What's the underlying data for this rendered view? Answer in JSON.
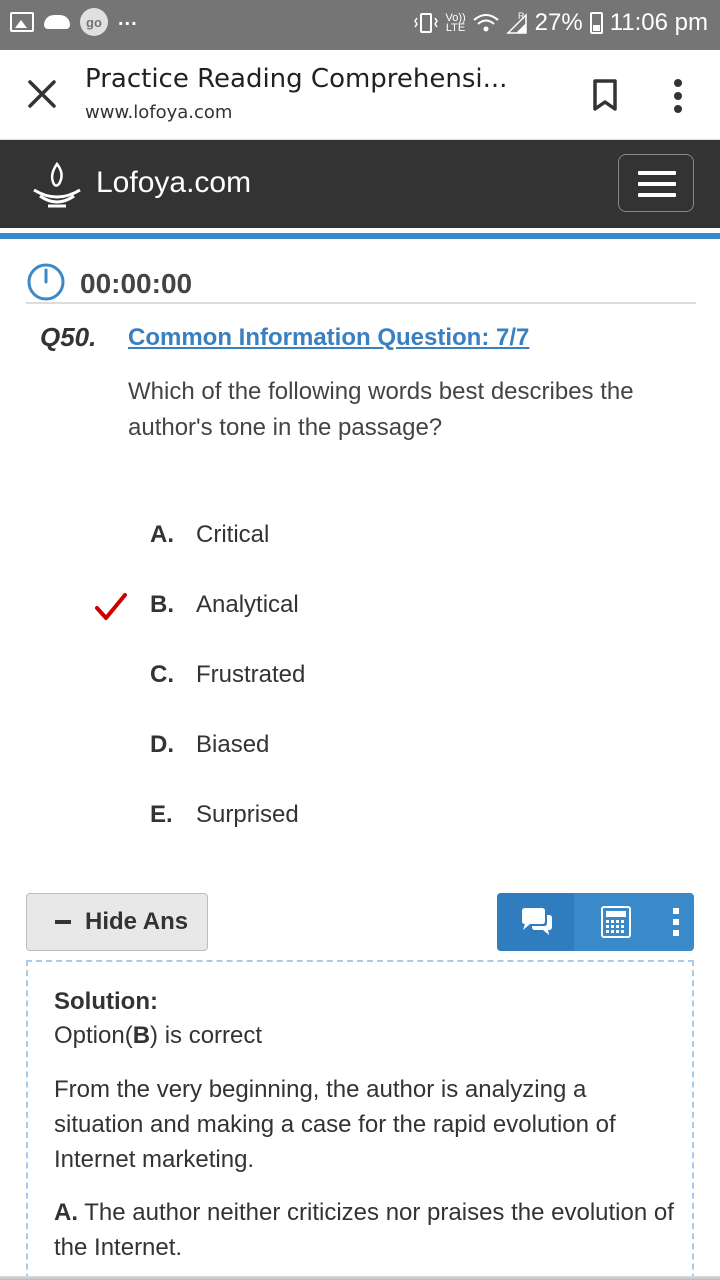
{
  "status_bar": {
    "go_badge": "go",
    "dots": "...",
    "volte_top": "Vo))",
    "volte_bottom": "LTE",
    "roaming": "R",
    "battery": "27%",
    "time": "11:06 pm"
  },
  "browser": {
    "title": "Practice Reading Comprehensi...",
    "url": "www.lofoya.com"
  },
  "site": {
    "name": "Lofoya.com"
  },
  "timer": {
    "value": "00:00:00"
  },
  "question": {
    "number": "Q50.",
    "link": "Common Information Question: 7/7",
    "text": "Which of the following words best describes the author's tone in the passage?",
    "options": [
      {
        "letter": "A.",
        "text": "Critical"
      },
      {
        "letter": "B.",
        "text": "Analytical"
      },
      {
        "letter": "C.",
        "text": "Frustrated"
      },
      {
        "letter": "D.",
        "text": "Biased"
      },
      {
        "letter": "E.",
        "text": "Surprised"
      }
    ],
    "correct_index": 1
  },
  "actions": {
    "hide_label": "Hide Ans"
  },
  "solution": {
    "title": "Solution:",
    "correct_prefix": "Option(",
    "correct_letter": "B",
    "correct_suffix": ") is correct",
    "paragraph": "From the very beginning, the author is analyzing a situation and making a case for the rapid evolution of Internet marketing.",
    "a_letter": "A.",
    "a_text": " The author neither criticizes nor praises the evolution of the Internet."
  },
  "colors": {
    "accent_blue": "#3a89c9",
    "header_dark": "#333333",
    "check_red": "#cc0000",
    "status_grey": "#757575"
  }
}
